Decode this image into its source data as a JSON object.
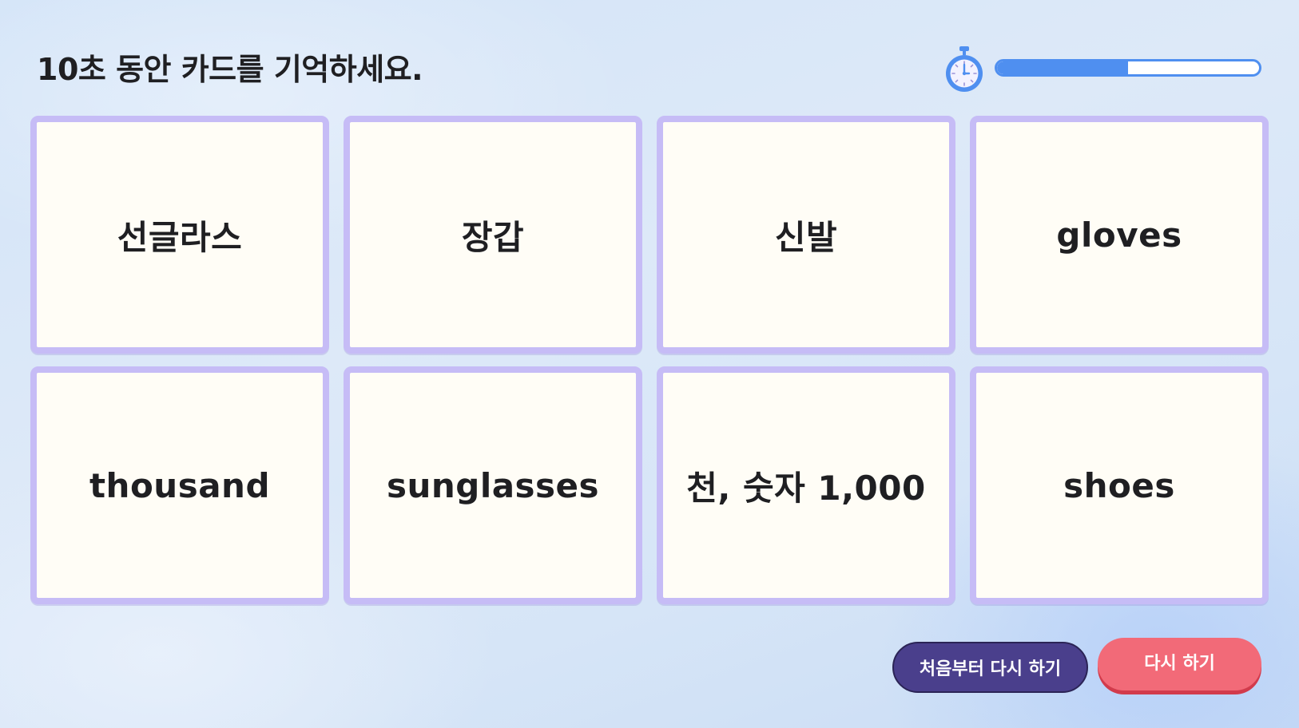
{
  "instruction": "10초 동안 카드를 기억하세요.",
  "timer": {
    "icon": "stopwatch-icon",
    "remaining_fraction": 0.5,
    "color": "#4f8ff0"
  },
  "cards": [
    {
      "label": "선글라스"
    },
    {
      "label": "장갑"
    },
    {
      "label": "신발"
    },
    {
      "label": "gloves"
    },
    {
      "label": "thousand"
    },
    {
      "label": "sunglasses"
    },
    {
      "label": "천, 숫자 1,000"
    },
    {
      "label": "shoes"
    }
  ],
  "buttons": {
    "restart_label": "처음부터 다시 하기",
    "retry_label": "다시 하기"
  },
  "colors": {
    "card_border": "#c6bcf6",
    "card_face": "#fffdf6",
    "restart_button": "#4a3f8c",
    "retry_button": "#f26a78"
  }
}
